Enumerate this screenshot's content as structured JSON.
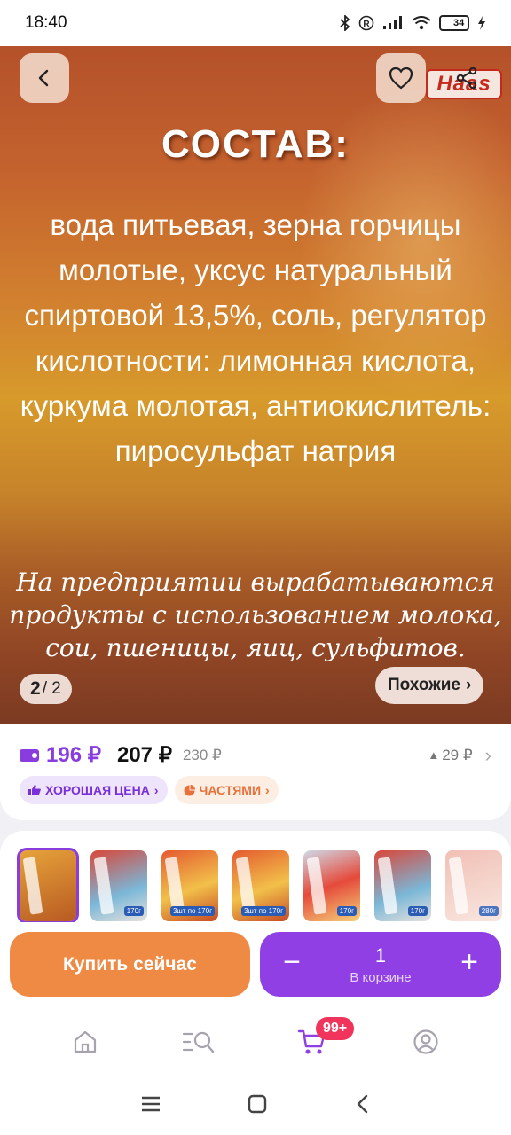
{
  "status_bar": {
    "time": "18:40",
    "battery_level": "34",
    "battery_fraction": 0.34,
    "icons": [
      "bluetooth-icon",
      "registered-icon",
      "signal-icon",
      "wifi-icon",
      "battery-icon",
      "charging-icon"
    ]
  },
  "hero": {
    "title": "СОСТАВ:",
    "body": "вода питьевая, зерна горчицы молотые, уксус натуральный спиртовой 13,5%, соль, регулятор кислотности: лимонная кислота, куркума молотая, антиокислитель: пиросульфат натрия",
    "note": "На предприятии вырабатываются продукты с использованием молока, сои, пшеницы, яиц, сульфитов.",
    "brand": "Haas",
    "pager_current": "2",
    "pager_total": "/ 2",
    "similar_label": "Похожие",
    "similar_chevron": "›"
  },
  "price": {
    "card_price": "196 ₽",
    "regular_price": "207 ₽",
    "old_price": "230 ₽",
    "diff": "29 ₽",
    "diff_arrow": "▲",
    "chevron": "›",
    "chips": {
      "good_price": "ХОРОШАЯ ЦЕНА",
      "parts": "ЧАСТЯМИ",
      "chevron": "›"
    }
  },
  "gallery": {
    "thumbnail_tags": [
      "",
      "170г",
      "3шт по 170г",
      "3шт по 170г",
      "170г",
      "170г",
      "280г"
    ]
  },
  "actions": {
    "buy_now": "Купить сейчас",
    "quantity": "1",
    "in_cart": "В корзине",
    "minus": "−",
    "plus": "+"
  },
  "bottom_nav": {
    "cart_badge": "99+",
    "items": [
      "home-icon",
      "catalog-search-icon",
      "cart-icon",
      "profile-icon"
    ]
  },
  "colors": {
    "accent": "#8f3fe4",
    "buy": "#ef8a45",
    "badge": "#f1345b"
  }
}
